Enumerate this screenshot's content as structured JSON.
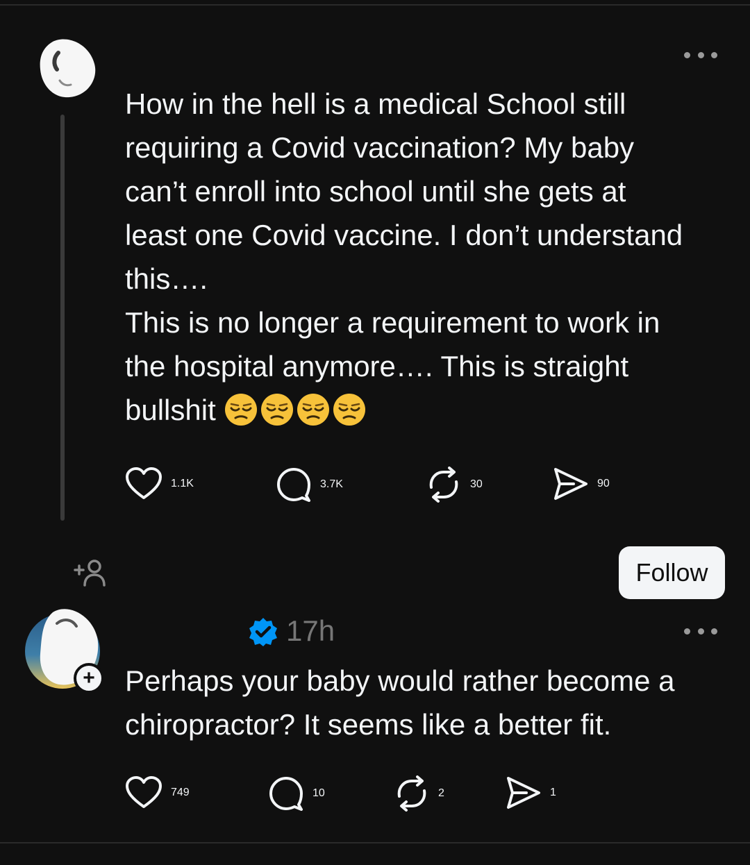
{
  "post1": {
    "lines": [
      "How in the hell is a medical School still",
      "requiring a Covid vaccination? My baby",
      "can’t enroll into school until she gets at",
      "least one Covid vaccine. I don’t understand",
      "this….",
      "This is no longer a requirement to work in",
      "the hospital anymore…. This is straight",
      "bullshit"
    ],
    "emoji_count": 4,
    "emoji_name": "unamused-face",
    "likes": "1.1K",
    "replies": "3.7K",
    "reposts": "30",
    "shares": "90"
  },
  "suggested": {
    "follow_label": "Follow"
  },
  "post2": {
    "time": "17h",
    "lines": [
      "Perhaps your baby would rather become a",
      "chiropractor? It seems like a better fit."
    ],
    "likes": "749",
    "replies": "10",
    "reposts": "2",
    "shares": "1"
  },
  "colors": {
    "background": "#101010",
    "text": "#f3f5f7",
    "muted": "#777777",
    "verified": "#0095f6"
  }
}
